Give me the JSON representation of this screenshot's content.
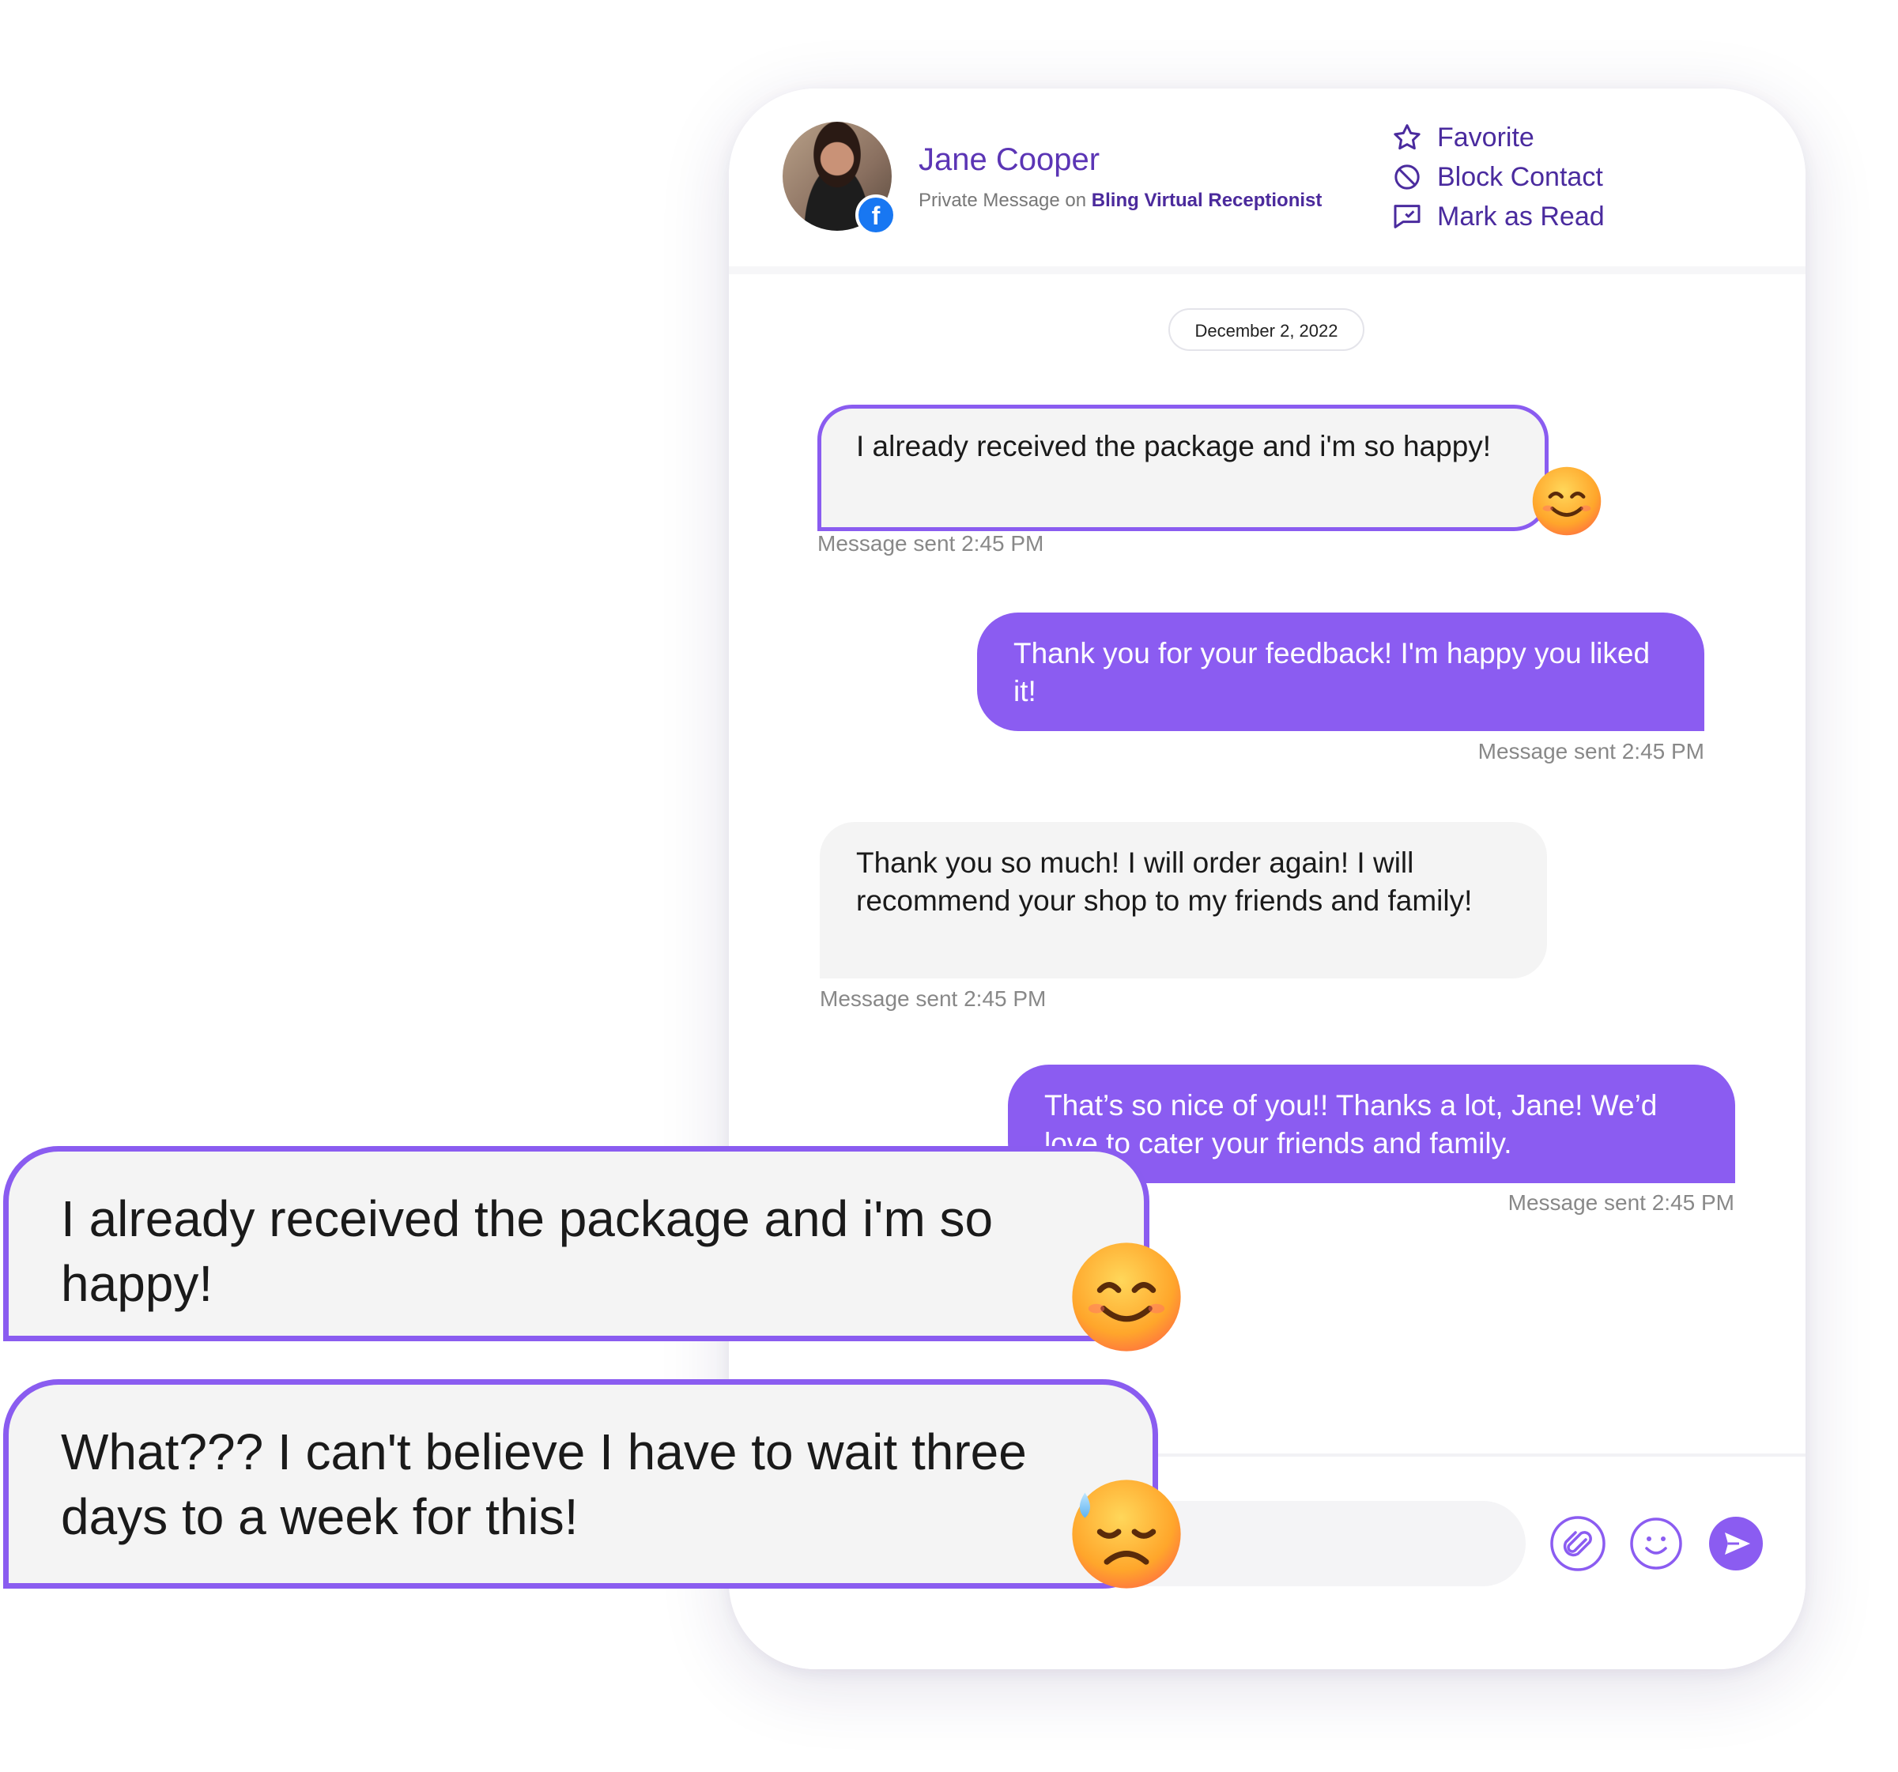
{
  "contact": {
    "name": "Jane Cooper",
    "subline_prefix": "Private Message on",
    "channel": "Bling Virtual Receptionist"
  },
  "actions": {
    "favorite": "Favorite",
    "block": "Block Contact",
    "mark_read": "Mark as Read"
  },
  "date_label": "December 2, 2022",
  "messages": [
    {
      "text": "I already received the package and i'm so happy!",
      "meta": "Message sent 2:45 PM"
    },
    {
      "text": "Thank you for your feedback! I'm happy you liked it!",
      "meta": "Message sent 2:45 PM"
    },
    {
      "text": "Thank you so much! I will order again! I will recommend your shop to my friends and family!",
      "meta": "Message sent 2:45 PM"
    },
    {
      "text": "That’s so nice of you!! Thanks a lot, Jane! We’d love to cater your friends and family.",
      "meta": "Message sent 2:45 PM"
    }
  ],
  "callouts": [
    {
      "text": "I already received the package and i'm so happy!"
    },
    {
      "text": "What??? I can't believe I have to wait three days to a week for this!"
    }
  ],
  "icons": {
    "favorite": "star-icon",
    "block": "block-icon",
    "mark_read": "chat-check-icon",
    "attach": "paperclip-icon",
    "emoji": "smiley-icon",
    "send": "send-icon",
    "platform_badge": "facebook-icon"
  },
  "colors": {
    "accent": "#8b5cf1",
    "accent_dark": "#4a2b9e",
    "bubble_in": "#f4f4f4"
  }
}
